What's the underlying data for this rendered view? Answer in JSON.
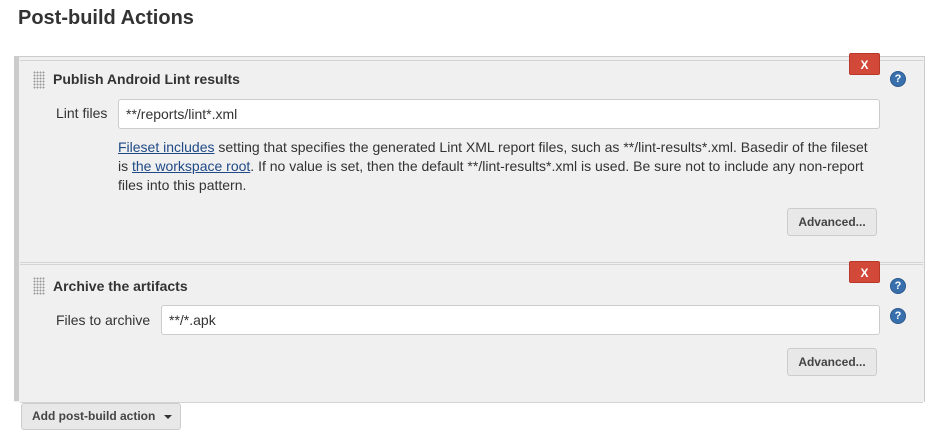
{
  "section": {
    "title": "Post-build Actions"
  },
  "panels": [
    {
      "title": "Publish Android Lint results",
      "delete_label": "X",
      "help_label": "?",
      "field_label": "Lint files",
      "field_value": "**/reports/lint*.xml",
      "description": {
        "link1": "Fileset includes",
        "text1": " setting that specifies the generated Lint XML report files, such as **/lint-results*.xml. Basedir of the fileset is ",
        "link2": "the workspace root",
        "text2": ". If no value is set, then the default **/lint-results*.xml is used. Be sure not to include any non-report files into this pattern."
      },
      "advanced_label": "Advanced..."
    },
    {
      "title": "Archive the artifacts",
      "delete_label": "X",
      "help_label": "?",
      "field_label": "Files to archive",
      "field_value": "**/*.apk",
      "field_help_label": "?",
      "advanced_label": "Advanced..."
    }
  ],
  "add_button": {
    "label": "Add post-build action"
  },
  "colors": {
    "delete": "#d24939",
    "help": "#3870ad",
    "link": "#204a87",
    "panel_bg": "#f0f0f0"
  }
}
